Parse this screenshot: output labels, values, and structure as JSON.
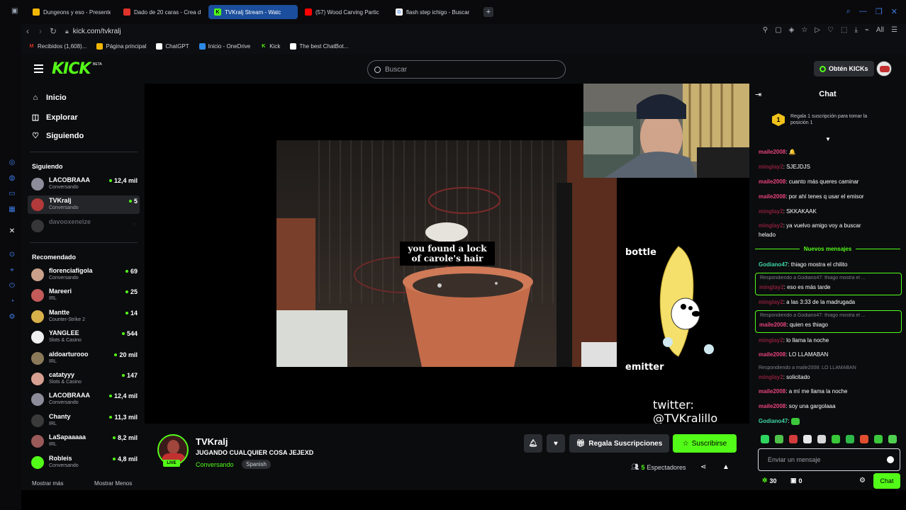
{
  "browser": {
    "tabs": [
      {
        "label": "Dungeons y eso - Presente",
        "fav_color": "#f2b705",
        "fav_glyph": ""
      },
      {
        "label": "Dado de 20 caras - Crea d",
        "fav_color": "#e0332b",
        "fav_glyph": ""
      },
      {
        "label": "TVKralj Stream - Watc",
        "fav_color": "#53fc18",
        "fav_glyph": "K",
        "active": true
      },
      {
        "label": "(57) Wood Carving Partic",
        "fav_color": "#ff0000",
        "fav_glyph": ""
      },
      {
        "label": "flash step ichigo - Buscar",
        "fav_color": "#ffffff",
        "fav_glyph": "G"
      }
    ],
    "new_tab_label": "+",
    "url": "kick.com/tvkralj",
    "bookmarks": [
      {
        "label": "Recibidos (1,608)...",
        "color": "#d93025",
        "glyph": "M"
      },
      {
        "label": "Página principal",
        "color": "#f2b705",
        "glyph": ""
      },
      {
        "label": "ChatGPT",
        "color": "#ffffff",
        "glyph": ""
      },
      {
        "label": "Inicio - OneDrive",
        "color": "#2d8ae6",
        "glyph": ""
      },
      {
        "label": "Kick",
        "color": "#53fc18",
        "glyph": "K"
      },
      {
        "label": "The best ChatBot...",
        "color": "#ffffff",
        "glyph": ""
      }
    ],
    "addr_right_text": "All"
  },
  "header": {
    "logo": "KICK",
    "logo_sup": "BETA",
    "search_placeholder": "Buscar",
    "get_kicks_label": "Obtén KICKs"
  },
  "leftnav": {
    "main": [
      {
        "label": "Inicio",
        "icon": "home-icon",
        "glyph": "⌂"
      },
      {
        "label": "Explorar",
        "icon": "explore-icon",
        "glyph": "◫"
      },
      {
        "label": "Siguiendo",
        "icon": "heart-icon",
        "glyph": "♡"
      }
    ],
    "following_title": "Siguiendo",
    "following": [
      {
        "name": "LACOBRAAA",
        "cat": "Conversando",
        "viewers": "12,4 mil",
        "color": "#8c8c9a"
      },
      {
        "name": "TVKralj",
        "cat": "Conversando",
        "viewers": "5",
        "color": "#b23a3a",
        "active": true
      },
      {
        "name": "davooxeneize",
        "cat": "",
        "viewers": "",
        "color": "#888888",
        "offline": true
      }
    ],
    "recommended_title": "Recomendado",
    "recommended": [
      {
        "name": "florenciafigola",
        "cat": "Conversando",
        "viewers": "69",
        "color": "#c9a08a"
      },
      {
        "name": "Mareeri",
        "cat": "IRL",
        "viewers": "25",
        "color": "#c45a5a"
      },
      {
        "name": "Mantte",
        "cat": "Counter-Strike 2",
        "viewers": "14",
        "color": "#d8b04a"
      },
      {
        "name": "YANGLEE",
        "cat": "Slots & Casino",
        "viewers": "544",
        "color": "#f0f0f0"
      },
      {
        "name": "aldoarturooo",
        "cat": "IRL",
        "viewers": "20 mil",
        "color": "#8a7a5a"
      },
      {
        "name": "catatyyy",
        "cat": "Slots & Casino",
        "viewers": "147",
        "color": "#d8a090"
      },
      {
        "name": "LACOBRAAA",
        "cat": "Conversando",
        "viewers": "12,4 mil",
        "color": "#8c8c9a"
      },
      {
        "name": "Chanty",
        "cat": "IRL",
        "viewers": "11,3 mil",
        "color": "#3a3a3a"
      },
      {
        "name": "LaSapaaaaa",
        "cat": "IRL",
        "viewers": "8,2 mil",
        "color": "#9a5a5a"
      },
      {
        "name": "Robleis",
        "cat": "Conversando",
        "viewers": "4,8 mil",
        "color": "#53fc18"
      }
    ],
    "show_more": "Mostrar más",
    "show_less": "Mostrar Menos"
  },
  "player": {
    "caption": "you found a lock of carole's hair",
    "meme_top": "bottle",
    "meme_bottom": "emitter",
    "twitter": "twitter: @TVKralillo"
  },
  "stream": {
    "name": "TVKralj",
    "title": "JUGANDO CUALQUIER COSA JEJEXD",
    "category": "Conversando",
    "language": "Spanish",
    "live": "LIVE",
    "gift_label": "Regala Suscripciones",
    "subscribe_label": "Suscribirse",
    "viewers_count": "5",
    "viewers_label": "Espectadores"
  },
  "chat": {
    "title": "Chat",
    "gift_banner": "Regala 1 suscripción para tomar la posición 1",
    "gift_badge": "1",
    "new_messages_label": "Nuevos mensajes",
    "input_placeholder": "Enviar un mensaje",
    "send_label": "Chat",
    "kicks_count": "30",
    "gift_count": "0",
    "messages_before": [
      {
        "user": "maile2008",
        "text": "🔔",
        "ucolor": "pink"
      },
      {
        "user": "minglay2",
        "text": "SJEJDJS",
        "ucolor": "dim"
      },
      {
        "user": "maile2008",
        "text": "cuanto más queres caminar",
        "ucolor": "pink"
      },
      {
        "user": "maile2008",
        "text": "por ahí tenes q usar el emisor",
        "ucolor": "pink"
      },
      {
        "user": "minglay2",
        "text": "SKKAKAAK",
        "ucolor": "dim"
      },
      {
        "user": "minglay2",
        "text": "ya vuelvo amigo voy a buscar",
        "ucolor": "dim",
        "cont": "helado"
      }
    ],
    "godiano_msg": {
      "user": "Godiano47",
      "text": "thiago mostra el chilito"
    },
    "reply1": {
      "ref": "Respondiendo a Godiano47: thiago mostra el ...",
      "user": "minglay2",
      "text": "eso es más tarde"
    },
    "mid_msg": {
      "user": "minglay2",
      "text": "a las 3:33 de la madrugada"
    },
    "reply2": {
      "ref": "Respondiendo a Godiano47: thiago mostra el ...",
      "user": "maile2008",
      "text": "quien es thiago"
    },
    "messages_after": [
      {
        "user": "minglay2",
        "text": "lo llama la noche",
        "ucolor": "dim"
      },
      {
        "user": "maile2008",
        "text": "LO LLAMABAN",
        "ucolor": "pink"
      }
    ],
    "ref3": "Respondiendo a maile2008: LO LLAMABAN",
    "messages_last": [
      {
        "user": "minglay2",
        "text": "solicitado",
        "ucolor": "dim"
      },
      {
        "user": "maile2008",
        "text": "a mí me llama la noche",
        "ucolor": "pink"
      },
      {
        "user": "maile2008",
        "text": "soy una gargolaaa",
        "ucolor": "pink"
      }
    ],
    "last_user": "Godiano47",
    "emote_colors": [
      "#2fd55f",
      "#4fc24a",
      "#d23c3c",
      "#e8e8e8",
      "#d8d8d8",
      "#38c838",
      "#2fb84a",
      "#e05030",
      "#3cc83c",
      "#50d050"
    ]
  }
}
